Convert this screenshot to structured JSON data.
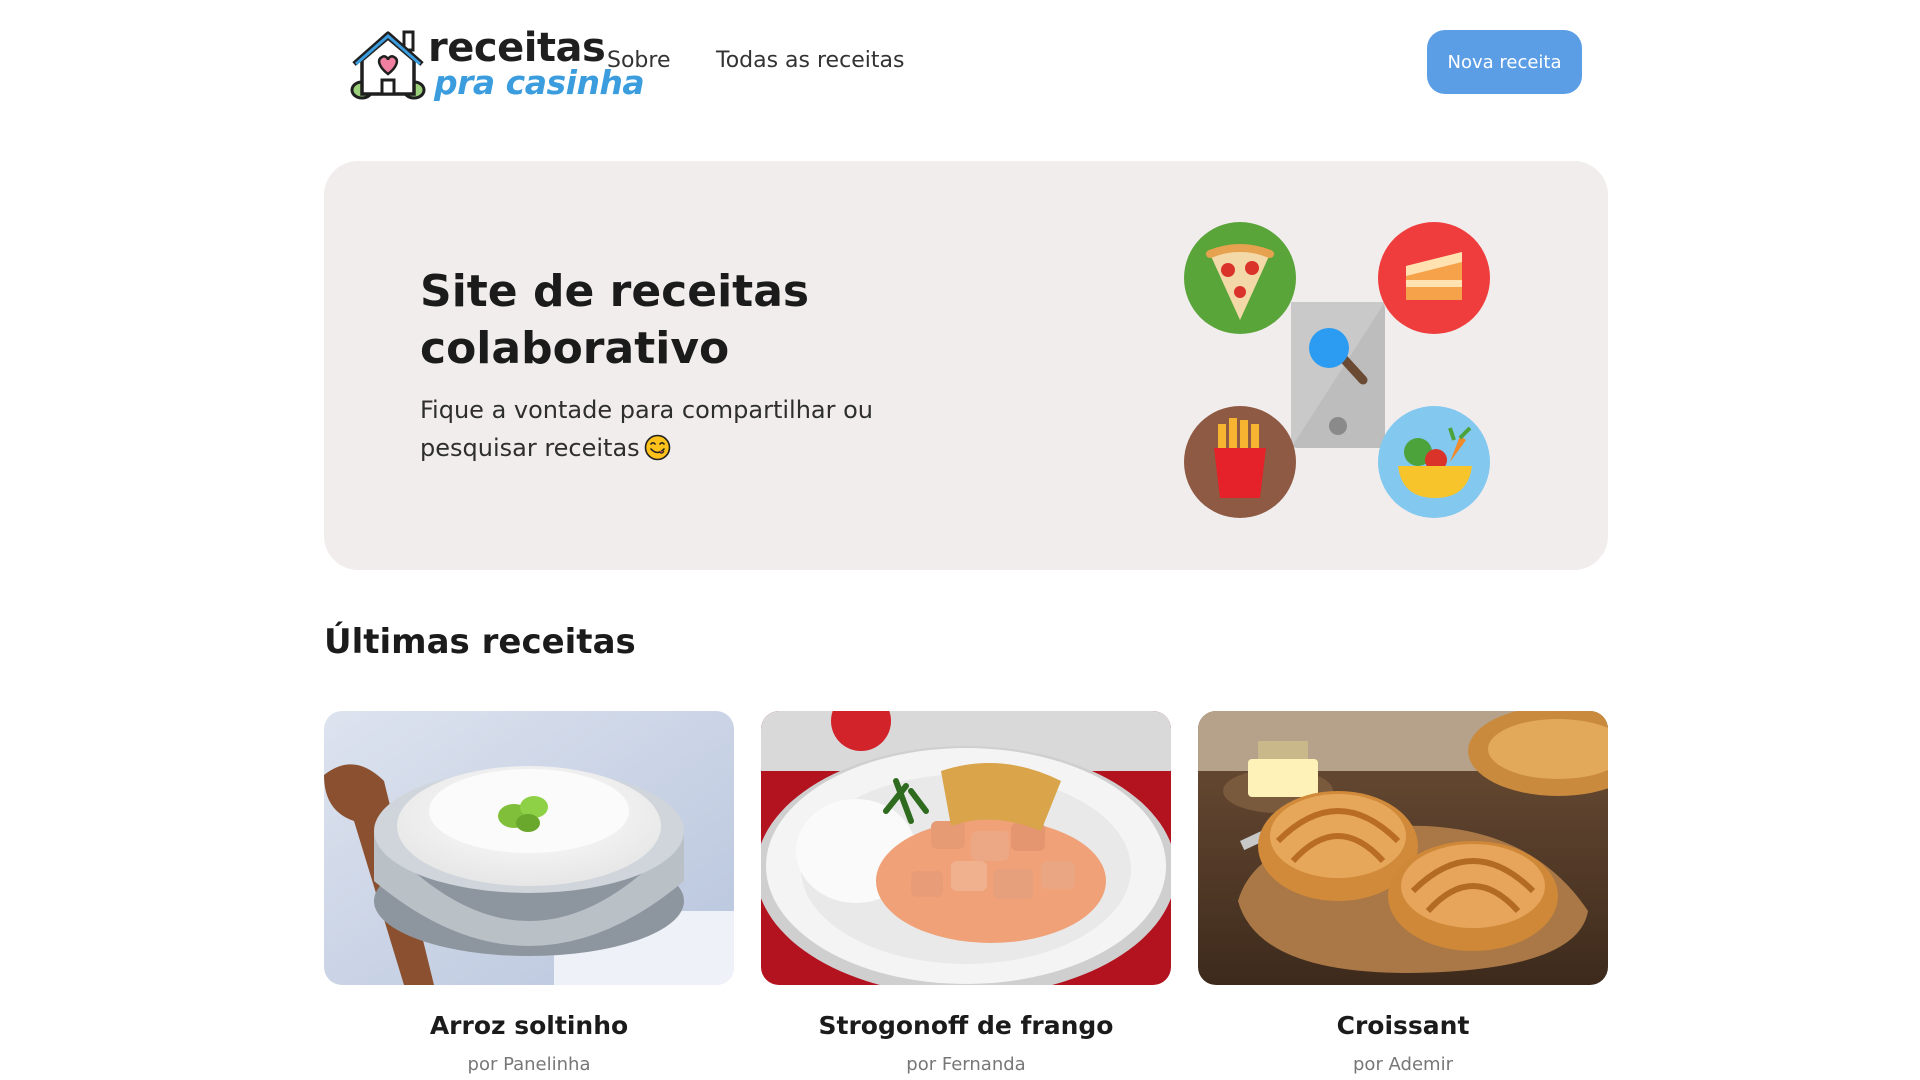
{
  "header": {
    "logo_line1": "receitas",
    "logo_line2": "pra casinha",
    "nav": [
      {
        "label": "Sobre"
      },
      {
        "label": "Todas as receitas"
      }
    ],
    "cta_label": "Nova receita"
  },
  "hero": {
    "title": "Site de receitas colaborativo",
    "subtitle": "Fique a vontade para compartilhar ou pesquisar receitas",
    "emoji": "savoring-food-emoji"
  },
  "section": {
    "title": "Últimas receitas"
  },
  "recipes": [
    {
      "title": "Arroz soltinho",
      "author": "por Panelinha",
      "image": "rice-bowl-photo"
    },
    {
      "title": "Strogonoff de frango",
      "author": "por Fernanda",
      "image": "chicken-strogonoff-photo"
    },
    {
      "title": "Croissant",
      "author": "por Ademir",
      "image": "croissant-photo"
    }
  ],
  "colors": {
    "accent": "#5b9ee6",
    "hero_bg": "#f2eded",
    "logo_blue": "#3b9dde"
  }
}
